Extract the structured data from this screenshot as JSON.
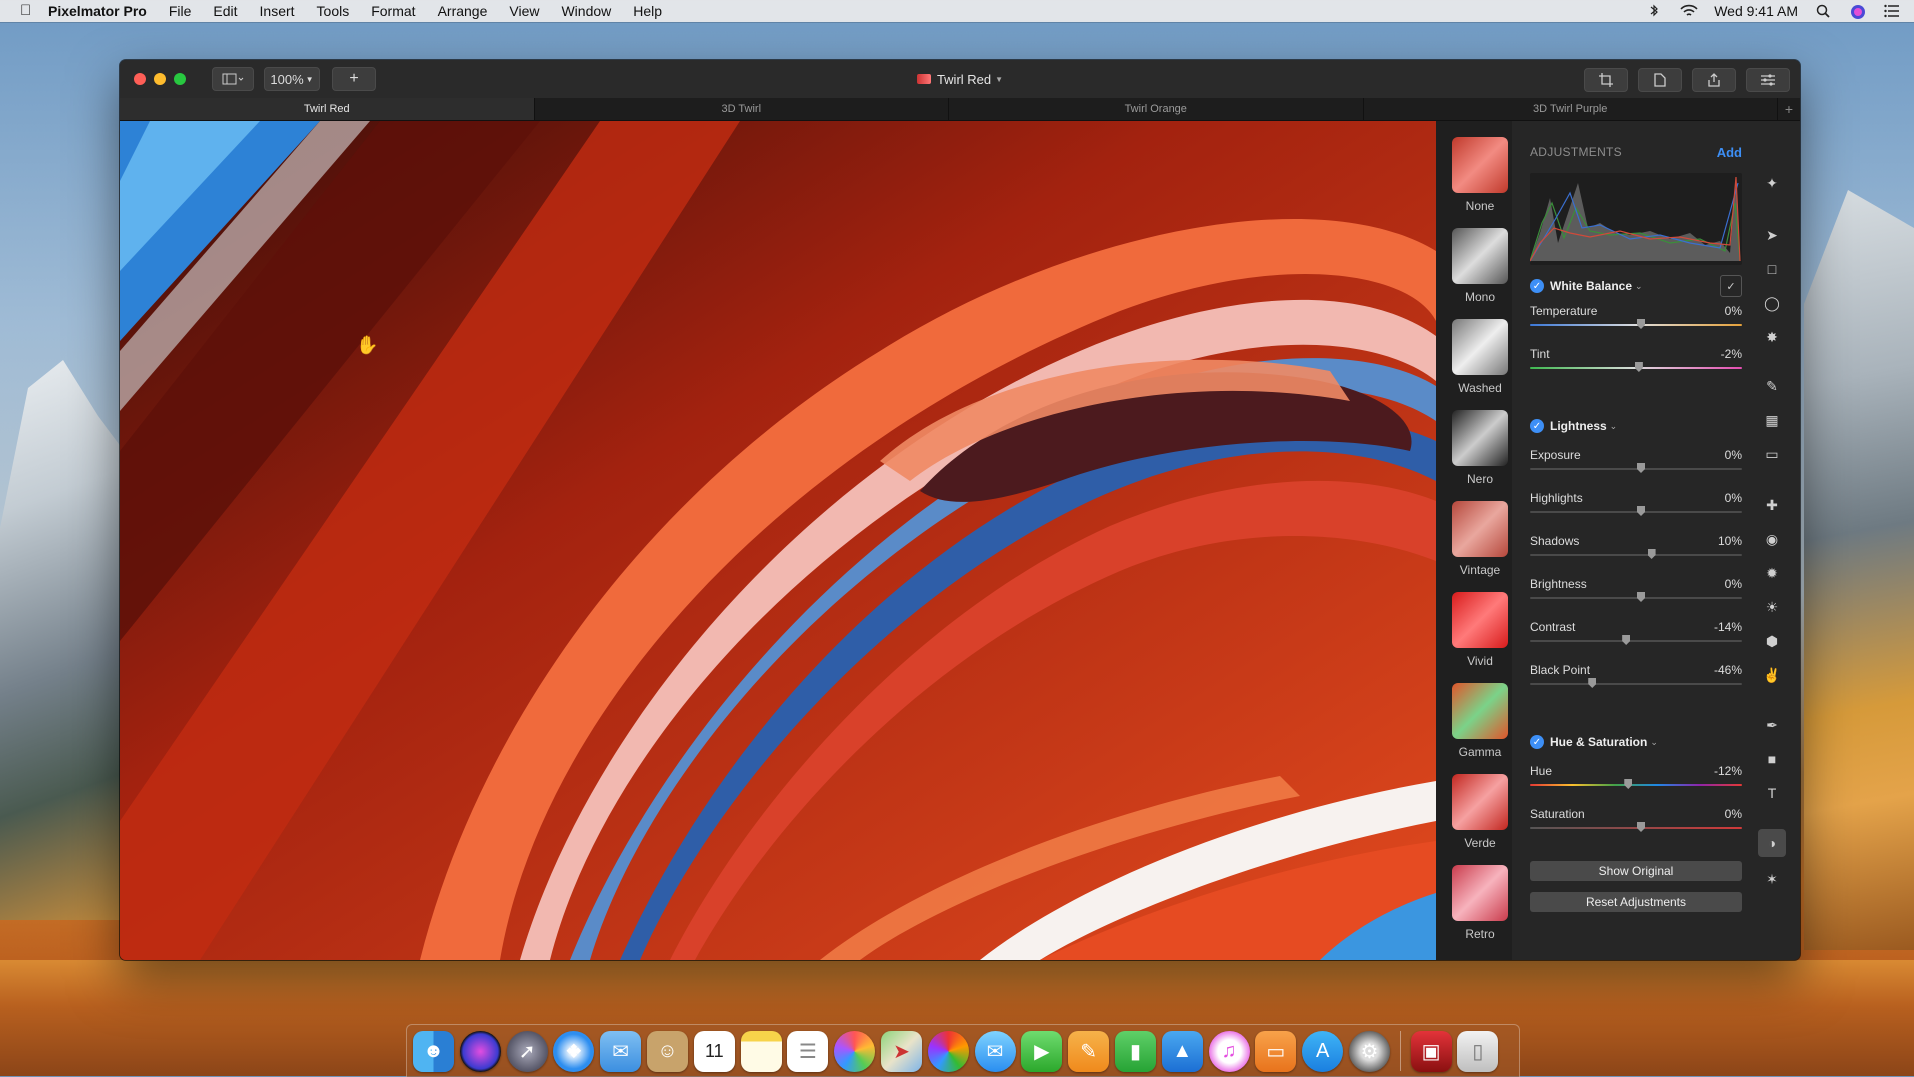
{
  "menubar": {
    "app_name": "Pixelmator Pro",
    "items": [
      "File",
      "Edit",
      "Insert",
      "Tools",
      "Format",
      "Arrange",
      "View",
      "Window",
      "Help"
    ],
    "clock": "Wed 9:41 AM"
  },
  "window": {
    "zoom": "100%",
    "title": "Twirl Red",
    "tabs": [
      "Twirl Red",
      "3D Twirl",
      "Twirl Orange",
      "3D Twirl Purple"
    ],
    "active_tab_index": 0
  },
  "presets": [
    {
      "label": "None",
      "colors": [
        "#c0392b",
        "#f28b82"
      ]
    },
    {
      "label": "Mono",
      "colors": [
        "#555555",
        "#dddddd"
      ]
    },
    {
      "label": "Washed",
      "colors": [
        "#777777",
        "#eeeeee"
      ]
    },
    {
      "label": "Nero",
      "colors": [
        "#222222",
        "#cccccc"
      ]
    },
    {
      "label": "Vintage",
      "colors": [
        "#b5473b",
        "#e9a79e"
      ]
    },
    {
      "label": "Vivid",
      "colors": [
        "#d81b1b",
        "#ff7a7a"
      ]
    },
    {
      "label": "Gamma",
      "colors": [
        "#e0552a",
        "#7bd389"
      ]
    },
    {
      "label": "Verde",
      "colors": [
        "#c2261f",
        "#f6a1a1"
      ]
    },
    {
      "label": "Retro",
      "colors": [
        "#c93b4c",
        "#f7b3bd"
      ]
    }
  ],
  "adjustments": {
    "title": "ADJUSTMENTS",
    "add_label": "Add",
    "white_balance": {
      "title": "White Balance",
      "temperature": {
        "label": "Temperature",
        "value": "0%",
        "level": 0
      },
      "tint": {
        "label": "Tint",
        "value": "-2%",
        "level": -2
      }
    },
    "lightness": {
      "title": "Lightness",
      "exposure": {
        "label": "Exposure",
        "value": "0%",
        "level": 0
      },
      "highlights": {
        "label": "Highlights",
        "value": "0%",
        "level": 0
      },
      "shadows": {
        "label": "Shadows",
        "value": "10%",
        "level": 10
      },
      "brightness": {
        "label": "Brightness",
        "value": "0%",
        "level": 0
      },
      "contrast": {
        "label": "Contrast",
        "value": "-14%",
        "level": -14
      },
      "black_point": {
        "label": "Black Point",
        "value": "-46%",
        "level": -46
      }
    },
    "hue_saturation": {
      "title": "Hue & Saturation",
      "hue": {
        "label": "Hue",
        "value": "-12%",
        "level": -12
      },
      "saturation": {
        "label": "Saturation",
        "value": "0%",
        "level": 0
      }
    },
    "show_original": "Show Original",
    "reset": "Reset Adjustments"
  },
  "tools": [
    "pointer-icon",
    "arrow-icon",
    "rect-select-icon",
    "lasso-icon",
    "magic-wand-icon",
    "brush-icon",
    "fill-icon",
    "eraser-icon",
    "repair-icon",
    "clone-icon",
    "blur-icon",
    "lighten-icon",
    "sponge-icon",
    "smudge-icon",
    "pen-icon",
    "shape-icon",
    "text-icon",
    "color-adjust-icon",
    "effects-icon"
  ],
  "dock": [
    "finder",
    "siri",
    "launchpad",
    "safari",
    "mail",
    "contacts",
    "calendar",
    "notes",
    "reminders",
    "photos",
    "maps",
    "pixelmator",
    "messages",
    "facetime",
    "pages",
    "numbers",
    "keynote",
    "itunes",
    "ibooks",
    "app-store",
    "system-preferences",
    "photo-booth",
    "trash"
  ],
  "calendar_day": "11"
}
